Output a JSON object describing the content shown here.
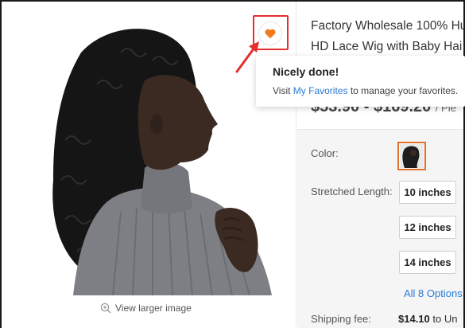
{
  "gallery": {
    "view_larger_label": "View larger image"
  },
  "favorite": {
    "icon": "heart-icon",
    "highlight_color": "#e62e2e",
    "icon_color": "#f07a1c"
  },
  "tooltip": {
    "title": "Nicely done!",
    "message_prefix": "Visit ",
    "link_text": "My Favorites",
    "message_suffix": " to manage your favorites."
  },
  "product": {
    "title_line1": "Factory Wholesale 100% Hu",
    "title_line2": "HD Lace Wig with Baby Hai",
    "price": "$53.90 - $169.20",
    "price_unit": "/ Pie"
  },
  "options": {
    "color_label": "Color:",
    "length_label": "Stretched Length:",
    "lengths": [
      "10 inches",
      "12 inches",
      "14 inches"
    ],
    "all_options_label": "All 8 Options",
    "shipping_label": "Shipping fee:",
    "shipping_value": "$14.10",
    "shipping_to": " to Un"
  },
  "colors": {
    "link": "#2b7bd6",
    "selected_border": "#e0702a"
  }
}
